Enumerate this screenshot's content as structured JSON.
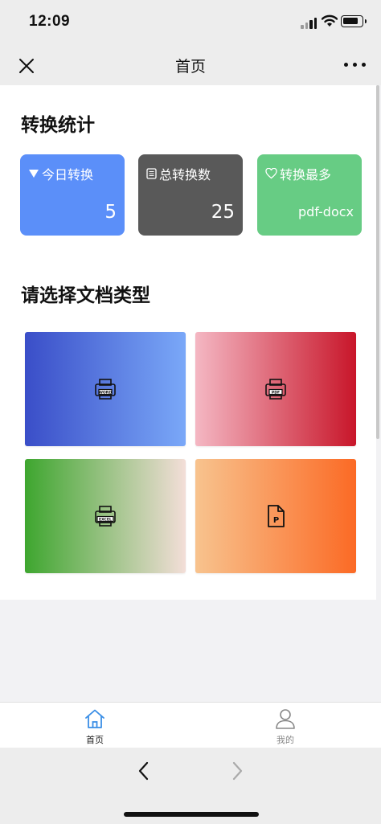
{
  "status_bar": {
    "time": "12:09"
  },
  "nav": {
    "title": "首页"
  },
  "stats": {
    "section_title": "转换统计",
    "cards": [
      {
        "label": "今日转换",
        "value": "5",
        "color": "#5b8ff9",
        "icon": "triangle-down-icon"
      },
      {
        "label": "总转换数",
        "value": "25",
        "color": "#595959",
        "icon": "list-icon"
      },
      {
        "label": "转换最多",
        "value": "pdf-docx",
        "color": "#67cc84",
        "icon": "heart-icon"
      }
    ]
  },
  "doc_types": {
    "section_title": "请选择文档类型",
    "tiles": [
      {
        "name": "word",
        "icon_text": "WORD"
      },
      {
        "name": "pdf",
        "icon_text": "PDF"
      },
      {
        "name": "excel",
        "icon_text": "EXCEL"
      },
      {
        "name": "ppt",
        "icon_text": "P"
      }
    ]
  },
  "tab_bar": {
    "tabs": [
      {
        "label": "首页",
        "icon": "home-icon",
        "active": true,
        "color": "#3a8ee6"
      },
      {
        "label": "我的",
        "icon": "user-icon",
        "active": false,
        "color": "#888888"
      }
    ]
  }
}
